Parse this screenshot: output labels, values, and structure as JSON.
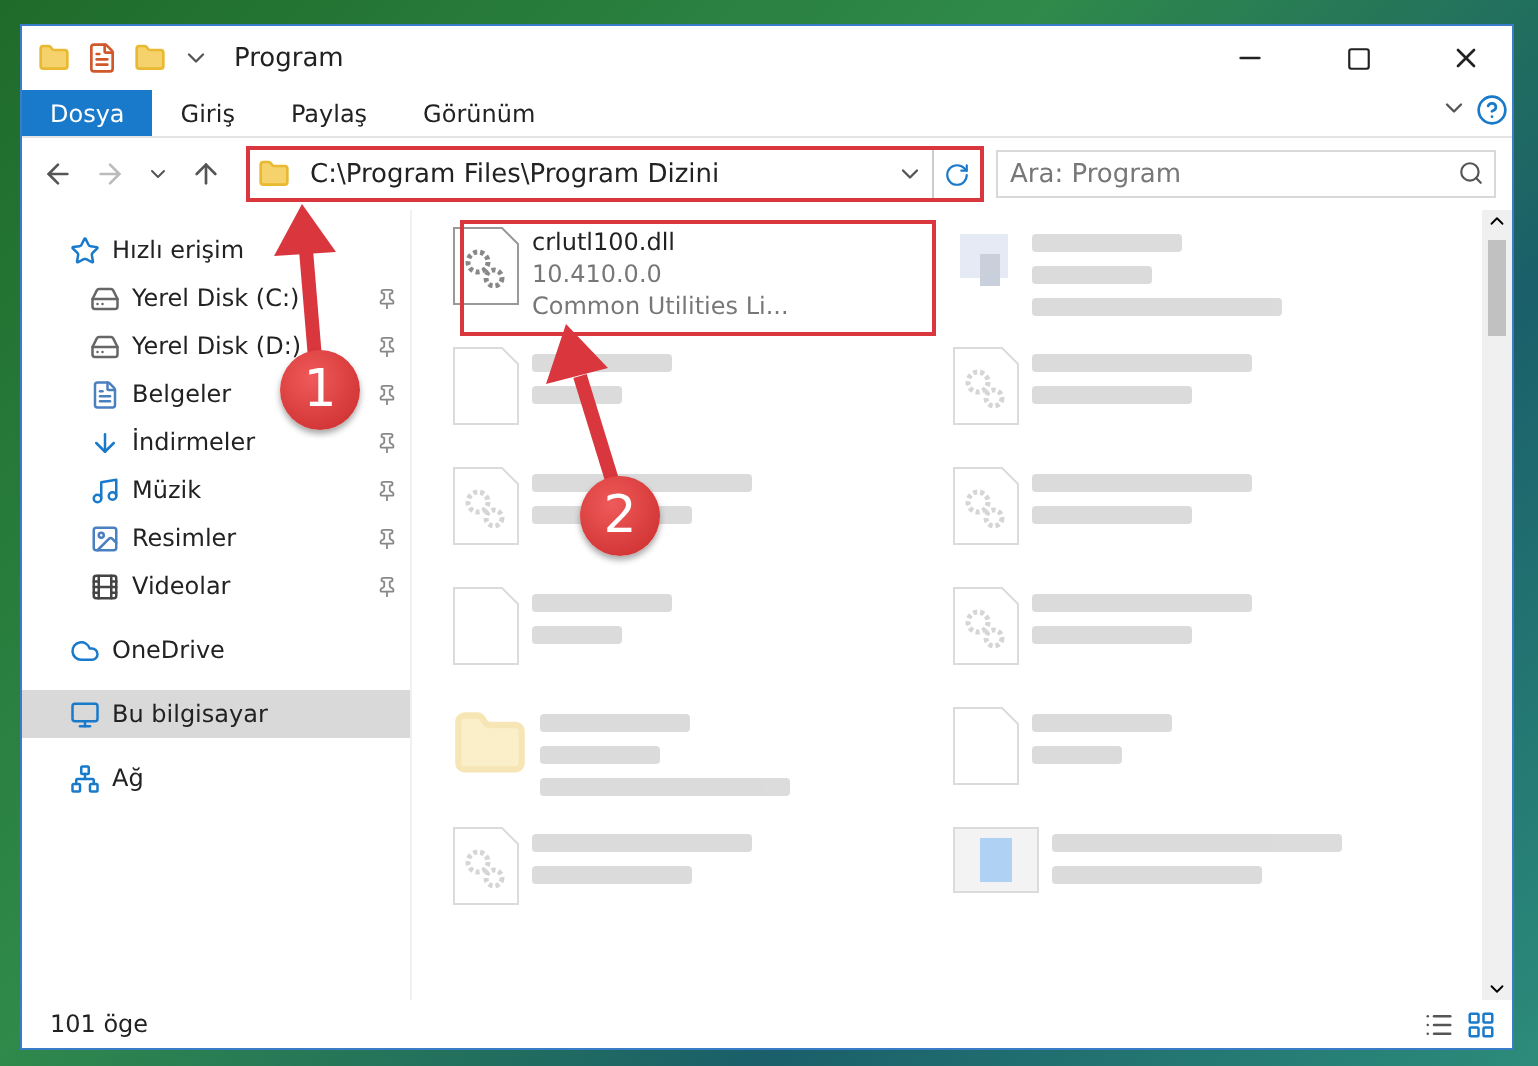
{
  "window": {
    "title": "Program"
  },
  "ribbon_tabs": [
    {
      "label": "Dosya",
      "selected": true
    },
    {
      "label": "Giriş",
      "selected": false
    },
    {
      "label": "Paylaş",
      "selected": false
    },
    {
      "label": "Görünüm",
      "selected": false
    }
  ],
  "address": {
    "value": "C:\\Program Files\\Program Dizini"
  },
  "search": {
    "placeholder": "Ara: Program"
  },
  "sidebar": {
    "items": [
      {
        "label": "Hızlı erişim",
        "kind": "quick",
        "selected": false,
        "children": [
          {
            "label": "Yerel Disk (C:)",
            "kind": "drive-c",
            "selected": false,
            "pinned": true
          },
          {
            "label": "Yerel Disk (D:)",
            "kind": "drive",
            "selected": false,
            "pinned": true
          },
          {
            "label": "Belgeler",
            "kind": "docs",
            "selected": false,
            "pinned": true
          },
          {
            "label": "İndirmeler",
            "kind": "downloads",
            "selected": false,
            "pinned": true
          },
          {
            "label": "Müzik",
            "kind": "music",
            "selected": false,
            "pinned": true
          },
          {
            "label": "Resimler",
            "kind": "pictures",
            "selected": false,
            "pinned": true
          },
          {
            "label": "Videolar",
            "kind": "videos",
            "selected": false,
            "pinned": true
          }
        ]
      },
      {
        "label": "OneDrive",
        "kind": "cloud",
        "selected": false
      },
      {
        "label": "Bu bilgisayar",
        "kind": "pc",
        "selected": true
      },
      {
        "label": "Ağ",
        "kind": "network",
        "selected": false
      }
    ]
  },
  "files": [
    {
      "name": "crlutl100.dll",
      "lines": [
        "10.410.0.0",
        "Common Utilities Li..."
      ],
      "kind": "dll",
      "blurred": false
    },
    {
      "kind": "exe",
      "blurred": true
    },
    {
      "kind": "blank",
      "blurred": true
    },
    {
      "kind": "dll",
      "blurred": true
    },
    {
      "kind": "dll",
      "blurred": true
    },
    {
      "kind": "dll",
      "blurred": true
    },
    {
      "kind": "blank",
      "blurred": true
    },
    {
      "kind": "dll",
      "blurred": true
    },
    {
      "kind": "folder",
      "blurred": true
    },
    {
      "kind": "blank",
      "blurred": true
    },
    {
      "kind": "dll",
      "blurred": true
    },
    {
      "kind": "installer",
      "blurred": true
    }
  ],
  "status_bar": {
    "count": "101 öge"
  },
  "annotations": [
    {
      "label": "1"
    },
    {
      "label": "2"
    }
  ]
}
